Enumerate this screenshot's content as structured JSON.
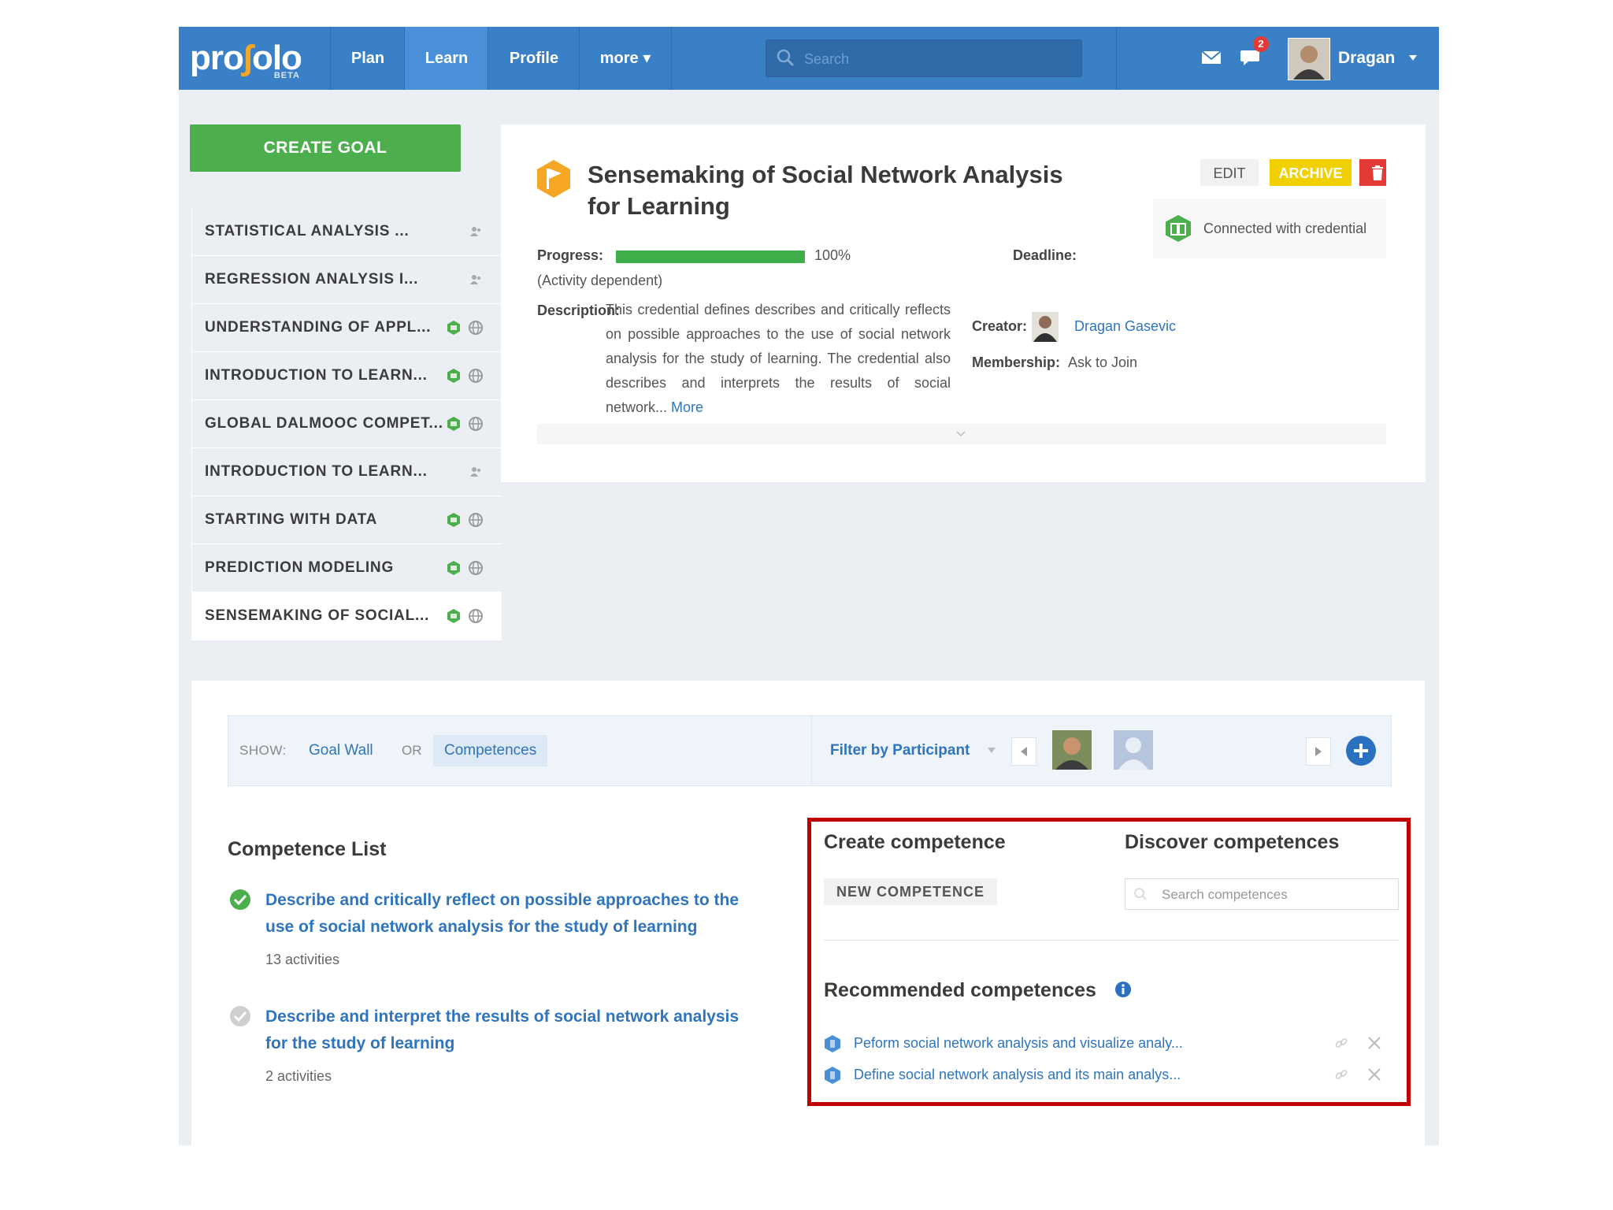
{
  "nav": {
    "logo": {
      "left": "pro",
      "slash": "∫",
      "right": "olo",
      "beta": "BETA"
    },
    "items": [
      {
        "label": "Plan"
      },
      {
        "label": "Learn"
      },
      {
        "label": "Profile"
      },
      {
        "label": "more ▾"
      }
    ],
    "active_item": "Learn",
    "search_placeholder": "Search",
    "notification_count": "2",
    "user_name": "Dragan",
    "accent_color": "#3a80c6"
  },
  "sidebar": {
    "create_goal_label": "CREATE GOAL",
    "goals": [
      {
        "label": "STATISTICAL ANALYSIS ...",
        "icons": [
          "people-icon"
        ]
      },
      {
        "label": "REGRESSION ANALYSIS I...",
        "icons": [
          "people-icon"
        ]
      },
      {
        "label": "UNDERSTANDING OF APPL...",
        "icons": [
          "credential-icon",
          "globe-icon"
        ]
      },
      {
        "label": "INTRODUCTION TO LEARN...",
        "icons": [
          "credential-icon",
          "globe-icon"
        ]
      },
      {
        "label": "GLOBAL DALMOOC COMPET...",
        "icons": [
          "credential-icon",
          "globe-icon"
        ]
      },
      {
        "label": "INTRODUCTION TO LEARN...",
        "icons": [
          "people-icon"
        ]
      },
      {
        "label": "STARTING WITH DATA",
        "icons": [
          "credential-icon",
          "globe-icon"
        ]
      },
      {
        "label": "PREDICTION MODELING",
        "icons": [
          "credential-icon",
          "globe-icon"
        ]
      },
      {
        "label": "SENSEMAKING OF SOCIAL...",
        "icons": [
          "credential-icon",
          "globe-icon"
        ]
      }
    ],
    "active_goal_index": 8
  },
  "goal": {
    "title": "Sensemaking of Social Network Analysis for Learning",
    "edit_label": "EDIT",
    "archive_label": "ARCHIVE",
    "credential_text": "Connected with credential",
    "progress_label": "Progress:",
    "progress_value": "100%",
    "progress_fraction": 1.0,
    "progress_note": "(Activity dependent)",
    "deadline_label": "Deadline:",
    "description_label": "Description:",
    "description": "This credential defines describes and critically reflects on possible approaches to the use of social network analysis for the study of learning. The credential also describes and interprets the results of social network...",
    "more_label": "More",
    "creator_label": "Creator:",
    "creator_name": "Dragan Gasevic",
    "membership_label": "Membership:",
    "membership_value": "Ask to Join"
  },
  "show_bar": {
    "show_label": "SHOW:",
    "goal_wall_label": "Goal Wall",
    "or_label": "OR",
    "competences_label": "Competences",
    "filter_label": "Filter by Participant"
  },
  "competence_list": {
    "title": "Competence List",
    "items": [
      {
        "title": "Describe and critically reflect on possible approaches to the use of social network analysis for the study of learning",
        "activities": "13 activities",
        "status": "completed"
      },
      {
        "title": "Describe and interpret the results of social network analysis for the study of learning",
        "activities": "2 activities",
        "status": "not-completed"
      }
    ]
  },
  "create_panel": {
    "create_title": "Create competence",
    "new_competence_label": "NEW COMPETENCE",
    "discover_title": "Discover competences",
    "search_placeholder": "Search competences",
    "recommended_title": "Recommended competences",
    "recommended": [
      {
        "text": "Peform social network analysis and visualize analy..."
      },
      {
        "text": "Define social network analysis and its main analys..."
      }
    ]
  }
}
